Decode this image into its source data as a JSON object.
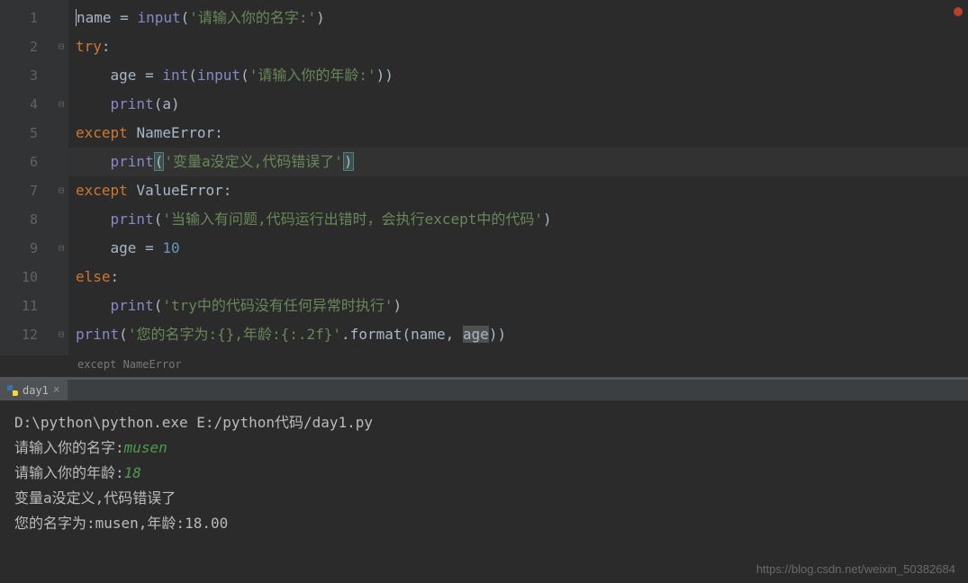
{
  "editor": {
    "lineNumbers": [
      "1",
      "2",
      "3",
      "4",
      "5",
      "6",
      "7",
      "8",
      "9",
      "10",
      "11",
      "12"
    ],
    "foldMarks": [
      "",
      "⊟",
      "",
      "⊟",
      "",
      "",
      "⊟",
      "",
      "⊟",
      "",
      "",
      "⊟"
    ],
    "breadcrumb": "except NameError",
    "lines": {
      "l1": {
        "name": "name",
        "eq": " = ",
        "input": "input",
        "op": "(",
        "str": "'请输入你的名字:'",
        "cp": ")"
      },
      "l2": {
        "try": "try",
        "colon": ":"
      },
      "l3": {
        "age": "age",
        "eq": " = ",
        "int": "int",
        "op1": "(",
        "input": "input",
        "op2": "(",
        "str": "'请输入你的年龄:'",
        "cp": "))"
      },
      "l4": {
        "print": "print",
        "op": "(",
        "a": "a",
        "cp": ")"
      },
      "l5": {
        "except": "except ",
        "err": "NameError",
        "colon": ":"
      },
      "l6": {
        "print": "print",
        "op": "(",
        "str": "'变量a没定义,代码错误了'",
        "cp": ")"
      },
      "l7": {
        "except": "except ",
        "err": "ValueError",
        "colon": ":"
      },
      "l8": {
        "print": "print",
        "op": "(",
        "str": "'当输入有问题,代码运行出错时，会执行except中的代码'",
        "cp": ")"
      },
      "l9": {
        "age": "age",
        "eq": " = ",
        "num": "10"
      },
      "l10": {
        "else": "else",
        "colon": ":"
      },
      "l11": {
        "print": "print",
        "op": "(",
        "str": "'try中的代码没有任何异常时执行'",
        "cp": ")"
      },
      "l12": {
        "print": "print",
        "op": "(",
        "str": "'您的名字为:{},年龄:{:.2f}'",
        "dot": ".format(",
        "name": "name",
        "comma": ", ",
        "age": "age",
        "cp": "))"
      }
    }
  },
  "tab": {
    "name": "day1",
    "close": "×"
  },
  "console": {
    "cmd": "D:\\python\\python.exe E:/python代码/day1.py",
    "p1_label": "请输入你的名字:",
    "p1_input": "musen",
    "p2_label": "请输入你的年龄:",
    "p2_input": "18",
    "out1": "变量a没定义,代码错误了",
    "out2": "您的名字为:musen,年龄:18.00"
  },
  "watermark": "https://blog.csdn.net/weixin_50382684"
}
